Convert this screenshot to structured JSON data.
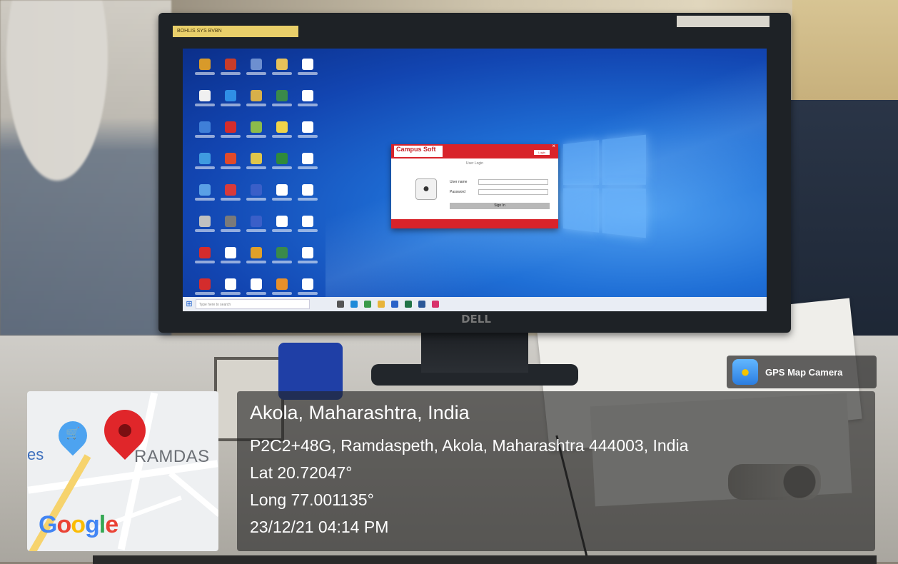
{
  "photo": {
    "monitor_brand": "DELL",
    "sticker_left": "BOHLIS SYS BVBN",
    "sticker_right": ""
  },
  "desktop": {
    "icon_colors": [
      "#d89a2a",
      "#c83c2a",
      "#6d8fd0",
      "#e7c25a",
      "#ffffff",
      "#f0f0f0",
      "#2f8fe6",
      "#d7b04a",
      "#3a8a4a",
      "#ffffff",
      "#3f7fd8",
      "#d42c2c",
      "#8cbb4a",
      "#f0d44a",
      "#ffffff",
      "#3f9be0",
      "#e04a2a",
      "#e0c64a",
      "#2f8a3a",
      "#ffffff",
      "#5aa0e6",
      "#d83a3a",
      "#3a5fc8",
      "#ffffff",
      "#ffffff",
      "#c0c0c0",
      "#7a7a7a",
      "#3a5fc8",
      "#ffffff",
      "#ffffff",
      "#d42c2c",
      "#ffffff",
      "#e0a02a",
      "#3a8a4a",
      "#ffffff",
      "#d42c2c",
      "#ffffff",
      "#ffffff",
      "#e8902a",
      "#ffffff"
    ]
  },
  "login_window": {
    "logo": "Campus Soft",
    "subtitle": "User Login",
    "username_label": "User name",
    "username_value": "",
    "password_label": "Password",
    "password_value": "",
    "signin_label": "Sign In",
    "footer": "",
    "header_button": "Login"
  },
  "taskbar": {
    "search_placeholder": "Type here to search",
    "tray_text": ""
  },
  "gps_badge": {
    "label": "GPS Map Camera"
  },
  "map": {
    "place_label": "RAMDAS",
    "partial_label": "es",
    "logo": "Google"
  },
  "location": {
    "place": "Akola, Maharashtra, India",
    "address": "P2C2+48G, Ramdaspeth, Akola, Maharashtra 444003, India",
    "lat": "Lat 20.72047°",
    "long": "Long 77.001135°",
    "datetime": "23/12/21 04:14 PM"
  }
}
